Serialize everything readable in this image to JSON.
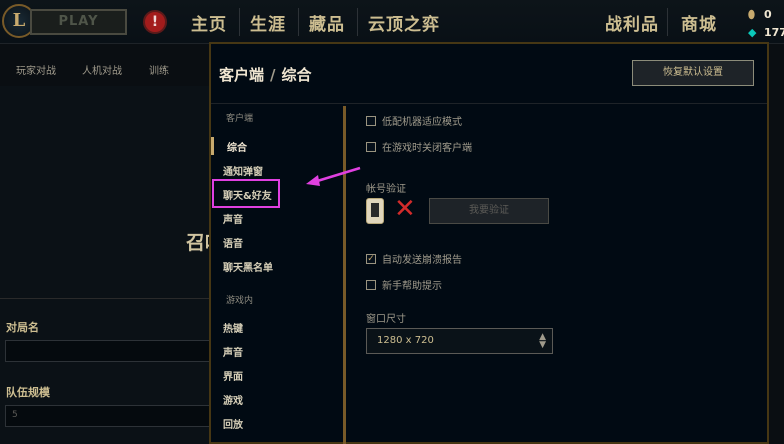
{
  "topbar": {
    "play_label": "PLAY",
    "alert_glyph": "!",
    "nav": [
      "主页",
      "生涯",
      "藏品",
      "云顶之弈"
    ],
    "right_nav": [
      "战利品",
      "商城"
    ],
    "currency": [
      "0",
      "177"
    ]
  },
  "background": {
    "subnav": [
      "玩家对战",
      "人机对战",
      "训练"
    ],
    "heading": "召唤",
    "fields": [
      {
        "label": "对局名",
        "value": ""
      },
      {
        "label": "队伍规模",
        "value": "5"
      }
    ]
  },
  "modal": {
    "title_section": "客户端",
    "title_separator": "/",
    "title_page": "综合",
    "reset_label": "恢复默认设置",
    "sidebar": {
      "section_client": "客户端",
      "client_items": [
        "综合",
        "通知弹窗",
        "聊天&好友",
        "声音",
        "语音",
        "聊天黑名单"
      ],
      "section_game": "游戏内",
      "game_items": [
        "热键",
        "声音",
        "界面",
        "游戏",
        "回放"
      ]
    },
    "options": {
      "low_spec": {
        "label": "低配机器适应模式",
        "checked": false
      },
      "close_in_game": {
        "label": "在游戏时关闭客户端",
        "checked": false
      },
      "account_verify_label": "帐号验证",
      "verify_button": "我要验证",
      "crash_report": {
        "label": "自动发送崩溃报告",
        "checked": true
      },
      "newbie_tips": {
        "label": "新手帮助提示",
        "checked": false
      },
      "window_size_label": "窗口尺寸",
      "window_size_value": "1280 x 720"
    }
  },
  "colors": {
    "accent_gold": "#c8aa6e",
    "highlight": "#e040e0",
    "error_red": "#d22b2b"
  }
}
